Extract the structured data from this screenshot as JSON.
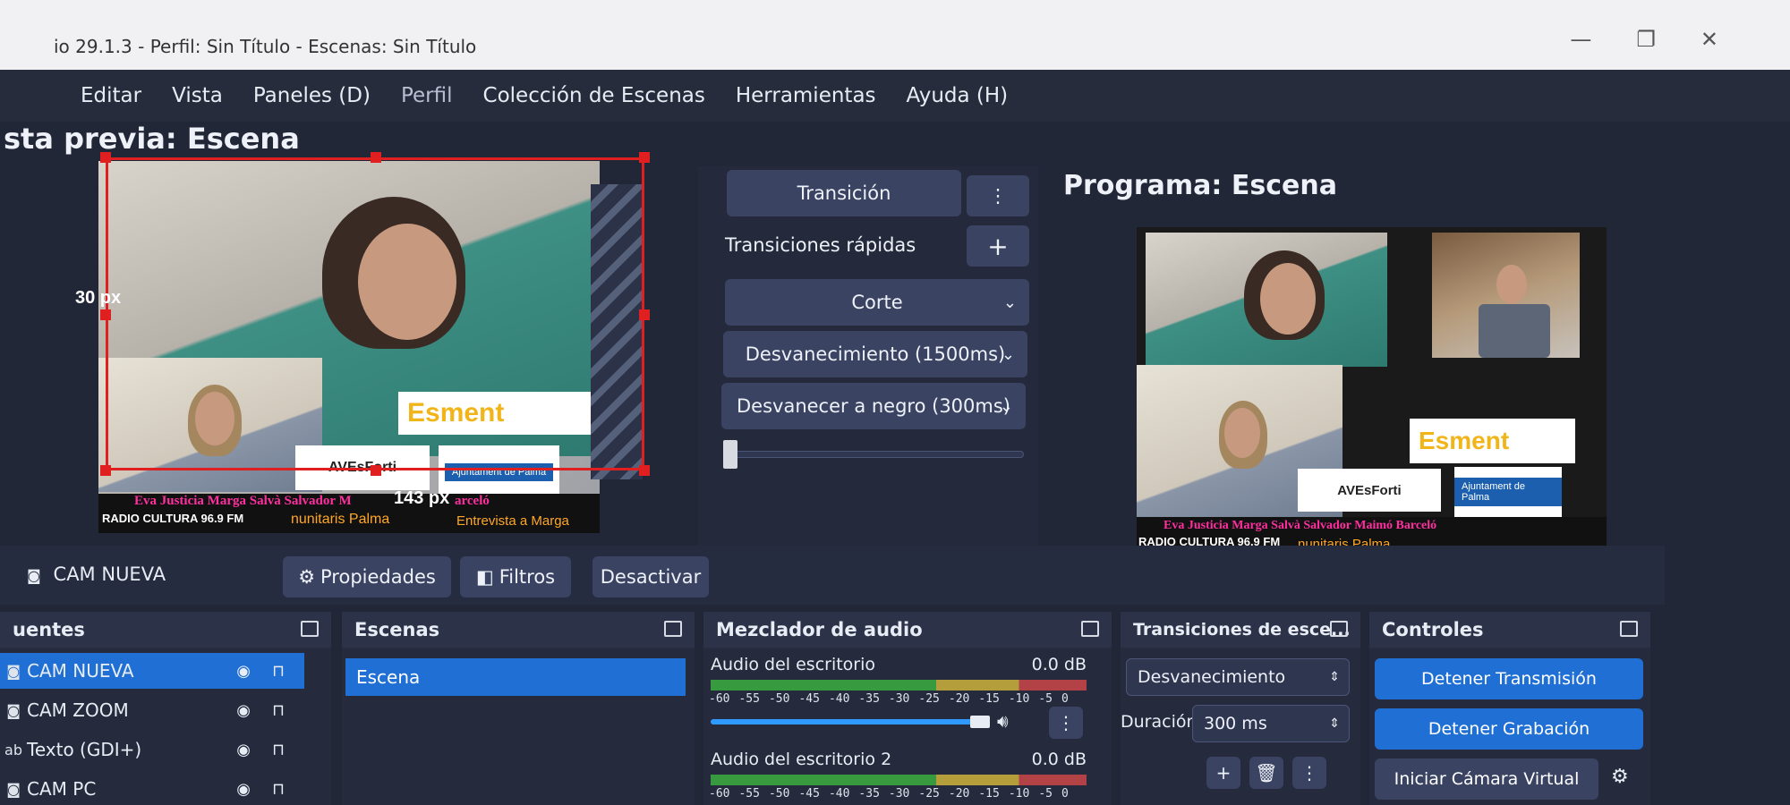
{
  "window": {
    "title": "io 29.1.3 - Perfil: Sin Título - Escenas: Sin Título"
  },
  "menu": [
    "Editar",
    "Vista",
    "Paneles (D)",
    "Perfil",
    "Colección de Escenas",
    "Herramientas",
    "Ayuda (H)"
  ],
  "preview": {
    "title": "sta previa: Escena",
    "left_offset_label": "30 px",
    "bottom_offset_label": "143 px"
  },
  "program": {
    "title": "Programa: Escena"
  },
  "overlay": {
    "esment": "Esment",
    "avesforti": "AVEsForti",
    "ajuntament": "Ajuntament de Palma",
    "names": "Eva Justicia  Marga Salvà  Salvador Maimó Barceló",
    "names_preview": "Eva Justicia  Marga Salvà  Salvador M",
    "names_preview_tail": "arceló",
    "radio": "RADIO CULTURA 96.9 FM",
    "community": "nunitaris Palma",
    "interview": "Entrevista a Marga"
  },
  "transitions_panel": {
    "transition_button": "Transición",
    "quick_label": "Transiciones rápidas",
    "items": [
      "Corte",
      "Desvanecimiento (1500ms)",
      "Desvanecer a negro (300ms)"
    ]
  },
  "source_bar": {
    "selected_source": "CAM NUEVA",
    "properties": "Propiedades",
    "filters": "Filtros",
    "deactivate": "Desactivar"
  },
  "sources": {
    "title": "uentes",
    "items": [
      {
        "label": "CAM NUEVA",
        "icon": "camera-icon"
      },
      {
        "label": "CAM ZOOM",
        "icon": "camera-icon"
      },
      {
        "label": "Texto (GDI+)",
        "icon": "text-icon"
      },
      {
        "label": "CAM PC",
        "icon": "camera-icon"
      }
    ],
    "text_icon_glyph": "ab"
  },
  "scenes": {
    "title": "Escenas",
    "items": [
      "Escena"
    ]
  },
  "mixer": {
    "title": "Mezclador de audio",
    "channels": [
      {
        "name": "Audio del escritorio",
        "db": "0.0 dB"
      },
      {
        "name": "Audio del escritorio 2",
        "db": "0.0 dB"
      }
    ],
    "ticks": [
      "-60",
      "-55",
      "-50",
      "-45",
      "-40",
      "-35",
      "-30",
      "-25",
      "-20",
      "-15",
      "-10",
      "-5",
      "0"
    ]
  },
  "scene_transitions": {
    "title": "Transiciones de esce...",
    "selected": "Desvanecimiento",
    "duration_label": "Duración",
    "duration_value": "300 ms"
  },
  "controls": {
    "title": "Controles",
    "stop_stream": "Detener Transmisión",
    "stop_record": "Detener Grabación",
    "virtual_cam": "Iniciar Cámara Virtual"
  },
  "colors": {
    "accent": "#1f6fd4",
    "selection": "#e02020",
    "ticker_names": "#ff2fa0",
    "ticker_orange": "#ffa726",
    "esment_yellow": "#f1b51a"
  }
}
